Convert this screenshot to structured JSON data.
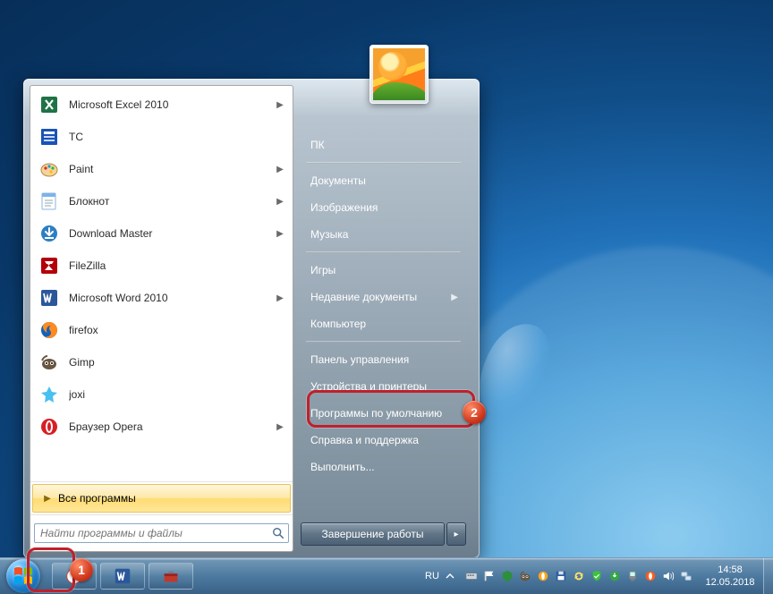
{
  "startmenu": {
    "programs": [
      {
        "label": "Microsoft Excel 2010",
        "icon": "excel",
        "submenu": true
      },
      {
        "label": "TC",
        "icon": "tc",
        "submenu": false
      },
      {
        "label": "Paint",
        "icon": "paint",
        "submenu": true
      },
      {
        "label": "Блокнот",
        "icon": "notepad",
        "submenu": true
      },
      {
        "label": "Download Master",
        "icon": "dm",
        "submenu": true
      },
      {
        "label": "FileZilla",
        "icon": "filezilla",
        "submenu": false
      },
      {
        "label": "Microsoft Word 2010",
        "icon": "word",
        "submenu": true
      },
      {
        "label": "firefox",
        "icon": "firefox",
        "submenu": false
      },
      {
        "label": "Gimp",
        "icon": "gimp",
        "submenu": false
      },
      {
        "label": "joxi",
        "icon": "joxi",
        "submenu": false
      },
      {
        "label": "Браузер Opera",
        "icon": "opera",
        "submenu": true
      }
    ],
    "all_programs": "Все программы",
    "search_placeholder": "Найти программы и файлы",
    "right": {
      "user": "ПК",
      "libs": [
        "Документы",
        "Изображения",
        "Музыка"
      ],
      "places": [
        "Игры",
        "Недавние документы",
        "Компьютер"
      ],
      "recent_has_sub": true,
      "ctrl": [
        "Панель управления",
        "Устройства и принтеры",
        "Программы по умолчанию",
        "Справка и поддержка",
        "Выполнить..."
      ]
    },
    "shutdown": "Завершение работы"
  },
  "taskbar": {
    "buttons": [
      {
        "name": "clock-app",
        "icon": "clock"
      },
      {
        "name": "word-app",
        "icon": "word"
      },
      {
        "name": "toolbox-app",
        "icon": "toolbox"
      }
    ],
    "lang": "RU",
    "tray_icons": [
      "keyboard",
      "flag",
      "firewall",
      "gimp",
      "opera-mini",
      "diskette",
      "sync",
      "shield",
      "torrent",
      "device",
      "opera-red",
      "volume",
      "network"
    ],
    "time": "14:58",
    "date": "12.05.2018"
  },
  "annotations": {
    "b1": "1",
    "b2": "2"
  }
}
